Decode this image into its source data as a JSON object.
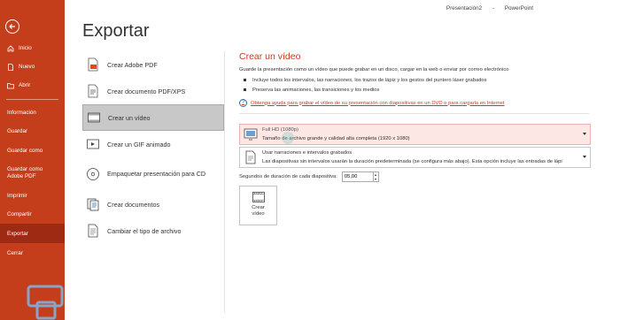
{
  "window": {
    "doc_name": "Presentación2",
    "separator": "-",
    "app_name": "PowerPoint"
  },
  "sidebar": {
    "top_items": [
      {
        "label": "Inicio",
        "icon": "home-icon"
      },
      {
        "label": "Nuevo",
        "icon": "new-document-icon"
      },
      {
        "label": "Abrir",
        "icon": "folder-icon"
      }
    ],
    "bottom_items": [
      {
        "label": "Información",
        "active": false
      },
      {
        "label": "Guardar",
        "active": false
      },
      {
        "label": "Guardar como",
        "active": false
      },
      {
        "label": "Guardar como Adobe PDF",
        "active": false
      },
      {
        "label": "Imprimir",
        "active": false
      },
      {
        "label": "Compartir",
        "active": false
      },
      {
        "label": "Exportar",
        "active": true
      },
      {
        "label": "Cerrar",
        "active": false
      }
    ]
  },
  "page_title": "Exportar",
  "options": [
    {
      "label": "Crear Adobe PDF",
      "icon": "adobe-pdf-icon"
    },
    {
      "label": "Crear documento PDF/XPS",
      "icon": "pdf-xps-icon"
    },
    {
      "label": "Crear un vídeo",
      "icon": "video-icon",
      "active": true
    },
    {
      "label": "Crear un GIF animado",
      "icon": "gif-icon"
    },
    {
      "label": "Empaquetar presentación para CD",
      "icon": "cd-icon"
    },
    {
      "label": "Crear documentos",
      "icon": "documents-icon"
    },
    {
      "label": "Cambiar el tipo de archivo",
      "icon": "file-type-icon"
    }
  ],
  "detail": {
    "title": "Crear un vídeo",
    "description": "Guarde la presentación como un vídeo que puede grabar en un disco, cargar en la web o enviar por correo electrónico",
    "bullets": [
      "Incluye todos los intervalos, las narraciones, los trazos de lápiz y los gestos del puntero láser grabados",
      "Preserva las animaciones, las transiciones y los medios"
    ],
    "help_link": "Obtenga ayuda para grabar el vídeo de su presentación con diapositivas en un DVD o para cargarla en Internet",
    "quality": {
      "title": "Full HD (1080p)",
      "subtitle": "Tamaño de archivo grande y calidad alta completa (1920 x 1080)"
    },
    "narration": {
      "title": "Usar narraciones e intervalos grabados",
      "subtitle": "Las diapositivas sin intervalos usarán la duración predeterminada (se configura más abajo). Esta opción incluye las entradas de lápi"
    },
    "duration_label": "Segundos de duración de cada diapositiva:",
    "duration_value": "05,00",
    "create_button": "Crear vídeo"
  },
  "colors": {
    "accent": "#c43e1c",
    "active_nav": "#9f2a13",
    "selected_row": "#c8c8c8"
  }
}
